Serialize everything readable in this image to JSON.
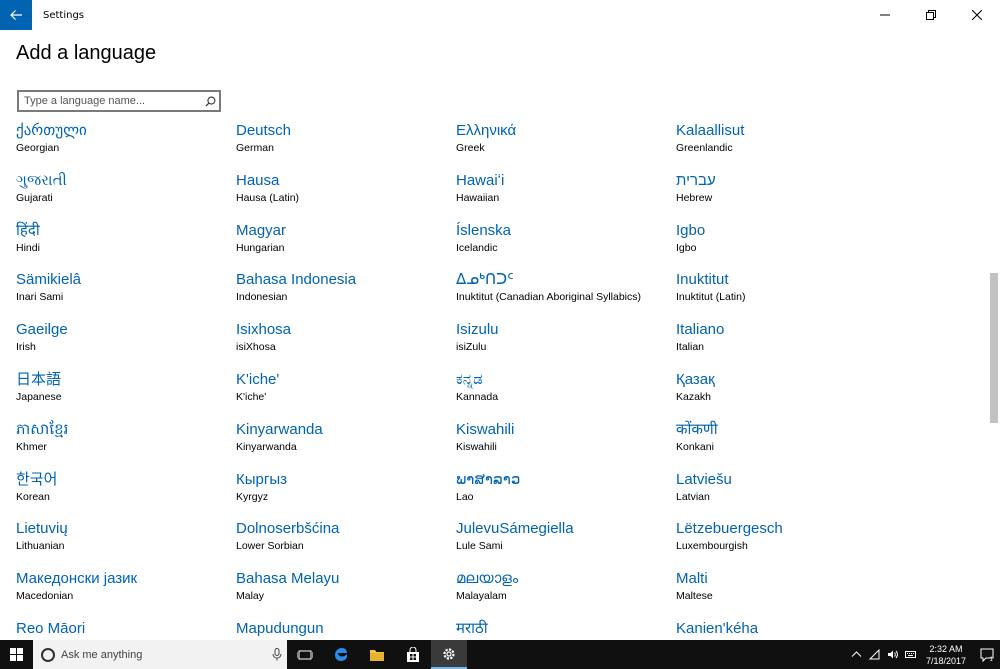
{
  "window": {
    "title": "Settings",
    "page_title": "Add a language"
  },
  "search": {
    "placeholder": "Type a language name..."
  },
  "languages": [
    {
      "native": "ქართული",
      "english": "Georgian"
    },
    {
      "native": "Deutsch",
      "english": "German"
    },
    {
      "native": "Ελληνικά",
      "english": "Greek"
    },
    {
      "native": "Kalaallisut",
      "english": "Greenlandic"
    },
    {
      "native": "ગુજરાતી",
      "english": "Gujarati"
    },
    {
      "native": "Hausa",
      "english": "Hausa (Latin)"
    },
    {
      "native": "Hawaiʻi",
      "english": "Hawaiian"
    },
    {
      "native": "עברית",
      "english": "Hebrew"
    },
    {
      "native": "हिंदी",
      "english": "Hindi"
    },
    {
      "native": "Magyar",
      "english": "Hungarian"
    },
    {
      "native": "Íslenska",
      "english": "Icelandic"
    },
    {
      "native": "Igbo",
      "english": "Igbo"
    },
    {
      "native": "Sämikielâ",
      "english": "Inari Sami"
    },
    {
      "native": "Bahasa Indonesia",
      "english": "Indonesian"
    },
    {
      "native": "ᐃᓄᒃᑎᑐᑦ",
      "english": "Inuktitut (Canadian Aboriginal Syllabics)"
    },
    {
      "native": "Inuktitut",
      "english": "Inuktitut (Latin)"
    },
    {
      "native": "Gaeilge",
      "english": "Irish"
    },
    {
      "native": "Isixhosa",
      "english": "isiXhosa"
    },
    {
      "native": "Isizulu",
      "english": "isiZulu"
    },
    {
      "native": "Italiano",
      "english": "Italian"
    },
    {
      "native": "日本語",
      "english": "Japanese"
    },
    {
      "native": "K'iche'",
      "english": "K'iche'"
    },
    {
      "native": "ಕನ್ನಡ",
      "english": "Kannada"
    },
    {
      "native": "Қазақ",
      "english": "Kazakh"
    },
    {
      "native": "ភាសាខ្មែរ",
      "english": "Khmer"
    },
    {
      "native": "Kinyarwanda",
      "english": "Kinyarwanda"
    },
    {
      "native": "Kiswahili",
      "english": "Kiswahili"
    },
    {
      "native": "कोंकणी",
      "english": "Konkani"
    },
    {
      "native": "한국어",
      "english": "Korean"
    },
    {
      "native": "Кыргыз",
      "english": "Kyrgyz"
    },
    {
      "native": "ພາສາລາວ",
      "english": "Lao"
    },
    {
      "native": "Latviešu",
      "english": "Latvian"
    },
    {
      "native": "Lietuvių",
      "english": "Lithuanian"
    },
    {
      "native": "Dolnoserbšćina",
      "english": "Lower Sorbian"
    },
    {
      "native": "JulevuSámegiella",
      "english": "Lule Sami"
    },
    {
      "native": "Lëtzebuergesch",
      "english": "Luxembourgish"
    },
    {
      "native": "Македонски јазик",
      "english": "Macedonian"
    },
    {
      "native": "Bahasa Melayu",
      "english": "Malay"
    },
    {
      "native": "മലയാളം",
      "english": "Malayalam"
    },
    {
      "native": "Malti",
      "english": "Maltese"
    },
    {
      "native": "Reo Māori",
      "english": ""
    },
    {
      "native": "Mapudungun",
      "english": ""
    },
    {
      "native": "मराठी",
      "english": ""
    },
    {
      "native": "Kanien'kéha",
      "english": ""
    }
  ],
  "taskbar": {
    "search_placeholder": "Ask me anything",
    "time": "2:32 AM",
    "date": "7/18/2017",
    "notification_count": "1"
  },
  "colors": {
    "accent": "#0063b1",
    "taskbar": "#101010"
  }
}
